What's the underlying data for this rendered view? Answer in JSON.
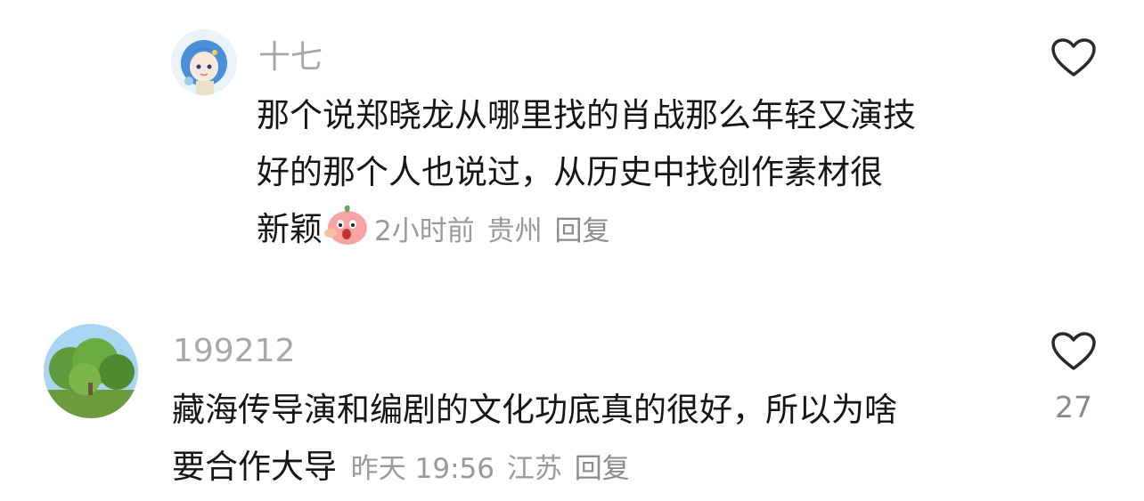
{
  "comments": [
    {
      "username": "十七",
      "text_lines": [
        "那个说郑晓龙从哪里找的肖战那么年轻又演技",
        "好的那个人也说过，从历史中找创作素材很",
        "新颖"
      ],
      "emoji": "angry-peach-emoji",
      "time": "2小时前",
      "location": "贵州",
      "reply_label": "回复",
      "like_count": "",
      "avatar": "anime-girl-avatar"
    },
    {
      "username": "199212",
      "text_lines": [
        "藏海传导演和编剧的文化功底真的很好，所以为啥",
        "要合作大导"
      ],
      "time": "昨天 19:56",
      "location": "江苏",
      "reply_label": "回复",
      "like_count": "27",
      "avatar": "tree-photo-avatar"
    }
  ],
  "colors": {
    "username": "#a8a8a8",
    "text": "#161616",
    "meta": "#9a9a9a",
    "icon": "#2a2a2a"
  }
}
